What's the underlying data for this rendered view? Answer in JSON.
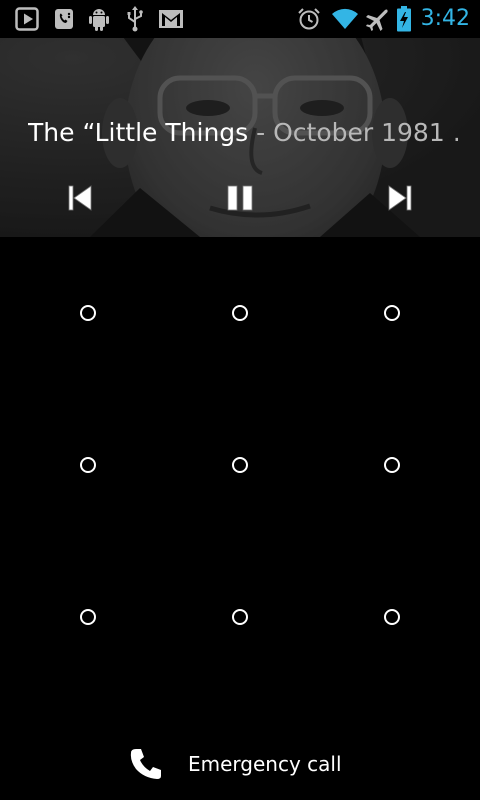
{
  "status_bar": {
    "time": "3:42",
    "left_icons": [
      "play-store-icon",
      "voicemail-icon",
      "android-debug-icon",
      "usb-icon",
      "gmail-icon"
    ],
    "right_icons": [
      "alarm-icon",
      "wifi-icon",
      "airplane-mode-icon",
      "battery-charging-icon"
    ],
    "accent_color": "#33b5e5"
  },
  "music": {
    "title": "The “Little Things",
    "separator": " - ",
    "artist": "October 1981 …",
    "controls": {
      "previous": "previous-track-icon",
      "pause": "pause-icon",
      "next": "next-track-icon"
    }
  },
  "pattern": {
    "rows": 3,
    "cols": 3
  },
  "emergency": {
    "label": "Emergency call",
    "icon": "phone-icon"
  }
}
